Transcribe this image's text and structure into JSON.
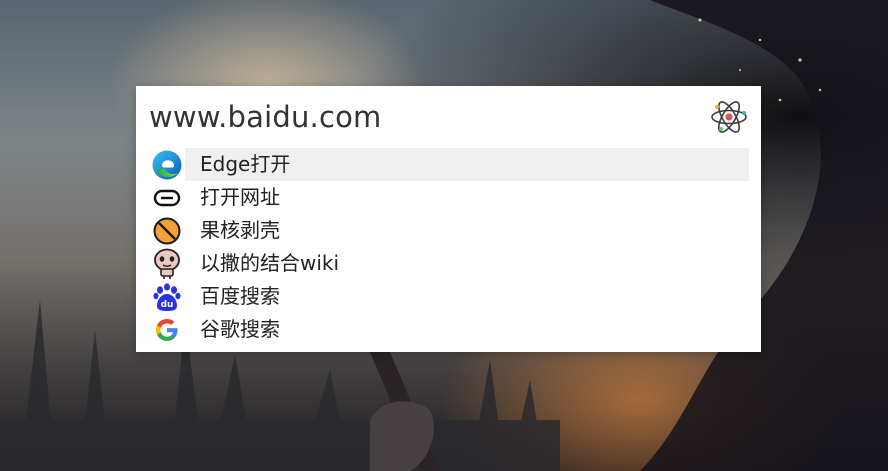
{
  "query": {
    "value": "www.baidu.com"
  },
  "app": {
    "icon": "atom-icon"
  },
  "results": [
    {
      "label": "Edge打开",
      "icon": "edge-icon",
      "selected": true
    },
    {
      "label": "打开网址",
      "icon": "link-icon",
      "selected": false
    },
    {
      "label": "果核剥壳",
      "icon": "forbidden-icon",
      "selected": false
    },
    {
      "label": "以撒的结合wiki",
      "icon": "isaac-icon",
      "selected": false
    },
    {
      "label": "百度搜索",
      "icon": "baidu-icon",
      "selected": false
    },
    {
      "label": "谷歌搜索",
      "icon": "google-icon",
      "selected": false
    }
  ],
  "colors": {
    "selected_bg": "#efefef",
    "panel_bg": "#ffffff",
    "text": "#222222"
  }
}
